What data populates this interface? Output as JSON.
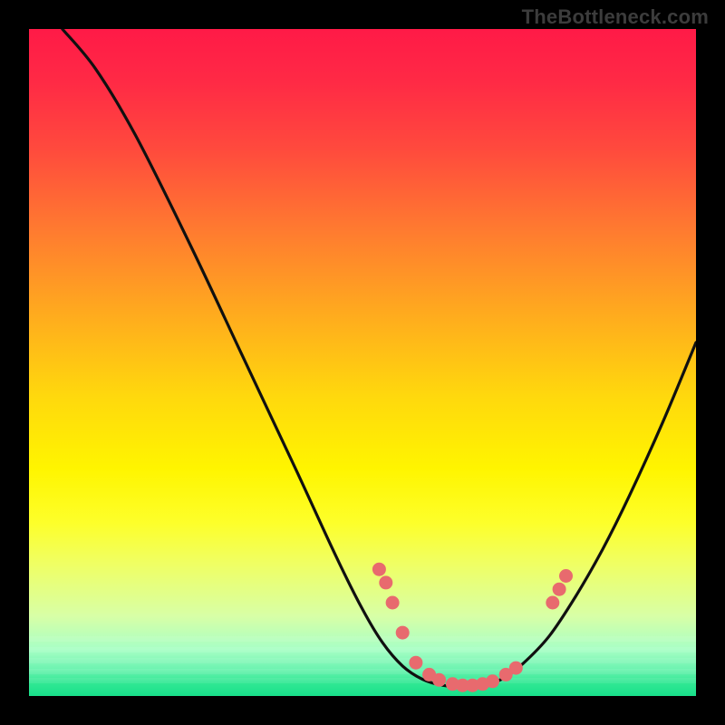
{
  "source_label": "TheBottleneck.com",
  "colors": {
    "dot": "#e86a6e",
    "curve": "#101010"
  },
  "chart_data": {
    "type": "line",
    "title": "",
    "xlabel": "",
    "ylabel": "",
    "xlim": [
      0,
      100
    ],
    "ylim": [
      0,
      100
    ],
    "curve": [
      {
        "x": 5,
        "y": 100
      },
      {
        "x": 10,
        "y": 94
      },
      {
        "x": 16,
        "y": 84
      },
      {
        "x": 24,
        "y": 68
      },
      {
        "x": 32,
        "y": 51
      },
      {
        "x": 40,
        "y": 34
      },
      {
        "x": 46,
        "y": 21
      },
      {
        "x": 50,
        "y": 13
      },
      {
        "x": 53,
        "y": 8
      },
      {
        "x": 56,
        "y": 4.5
      },
      {
        "x": 59,
        "y": 2.5
      },
      {
        "x": 62,
        "y": 1.6
      },
      {
        "x": 65,
        "y": 1.4
      },
      {
        "x": 68,
        "y": 1.6
      },
      {
        "x": 71,
        "y": 2.6
      },
      {
        "x": 74,
        "y": 4.8
      },
      {
        "x": 78,
        "y": 9
      },
      {
        "x": 82,
        "y": 15
      },
      {
        "x": 86,
        "y": 22
      },
      {
        "x": 90,
        "y": 30
      },
      {
        "x": 95,
        "y": 41
      },
      {
        "x": 100,
        "y": 53
      }
    ],
    "dots": [
      {
        "x": 52.5,
        "y": 19
      },
      {
        "x": 53.5,
        "y": 17
      },
      {
        "x": 54.5,
        "y": 14
      },
      {
        "x": 56,
        "y": 9.5
      },
      {
        "x": 58,
        "y": 5
      },
      {
        "x": 60,
        "y": 3.2
      },
      {
        "x": 61.5,
        "y": 2.4
      },
      {
        "x": 63.5,
        "y": 1.8
      },
      {
        "x": 65,
        "y": 1.6
      },
      {
        "x": 66.5,
        "y": 1.6
      },
      {
        "x": 68,
        "y": 1.8
      },
      {
        "x": 69.5,
        "y": 2.2
      },
      {
        "x": 71.5,
        "y": 3.2
      },
      {
        "x": 73,
        "y": 4.2
      },
      {
        "x": 78.5,
        "y": 14
      },
      {
        "x": 79.5,
        "y": 16
      },
      {
        "x": 80.5,
        "y": 18
      }
    ]
  }
}
